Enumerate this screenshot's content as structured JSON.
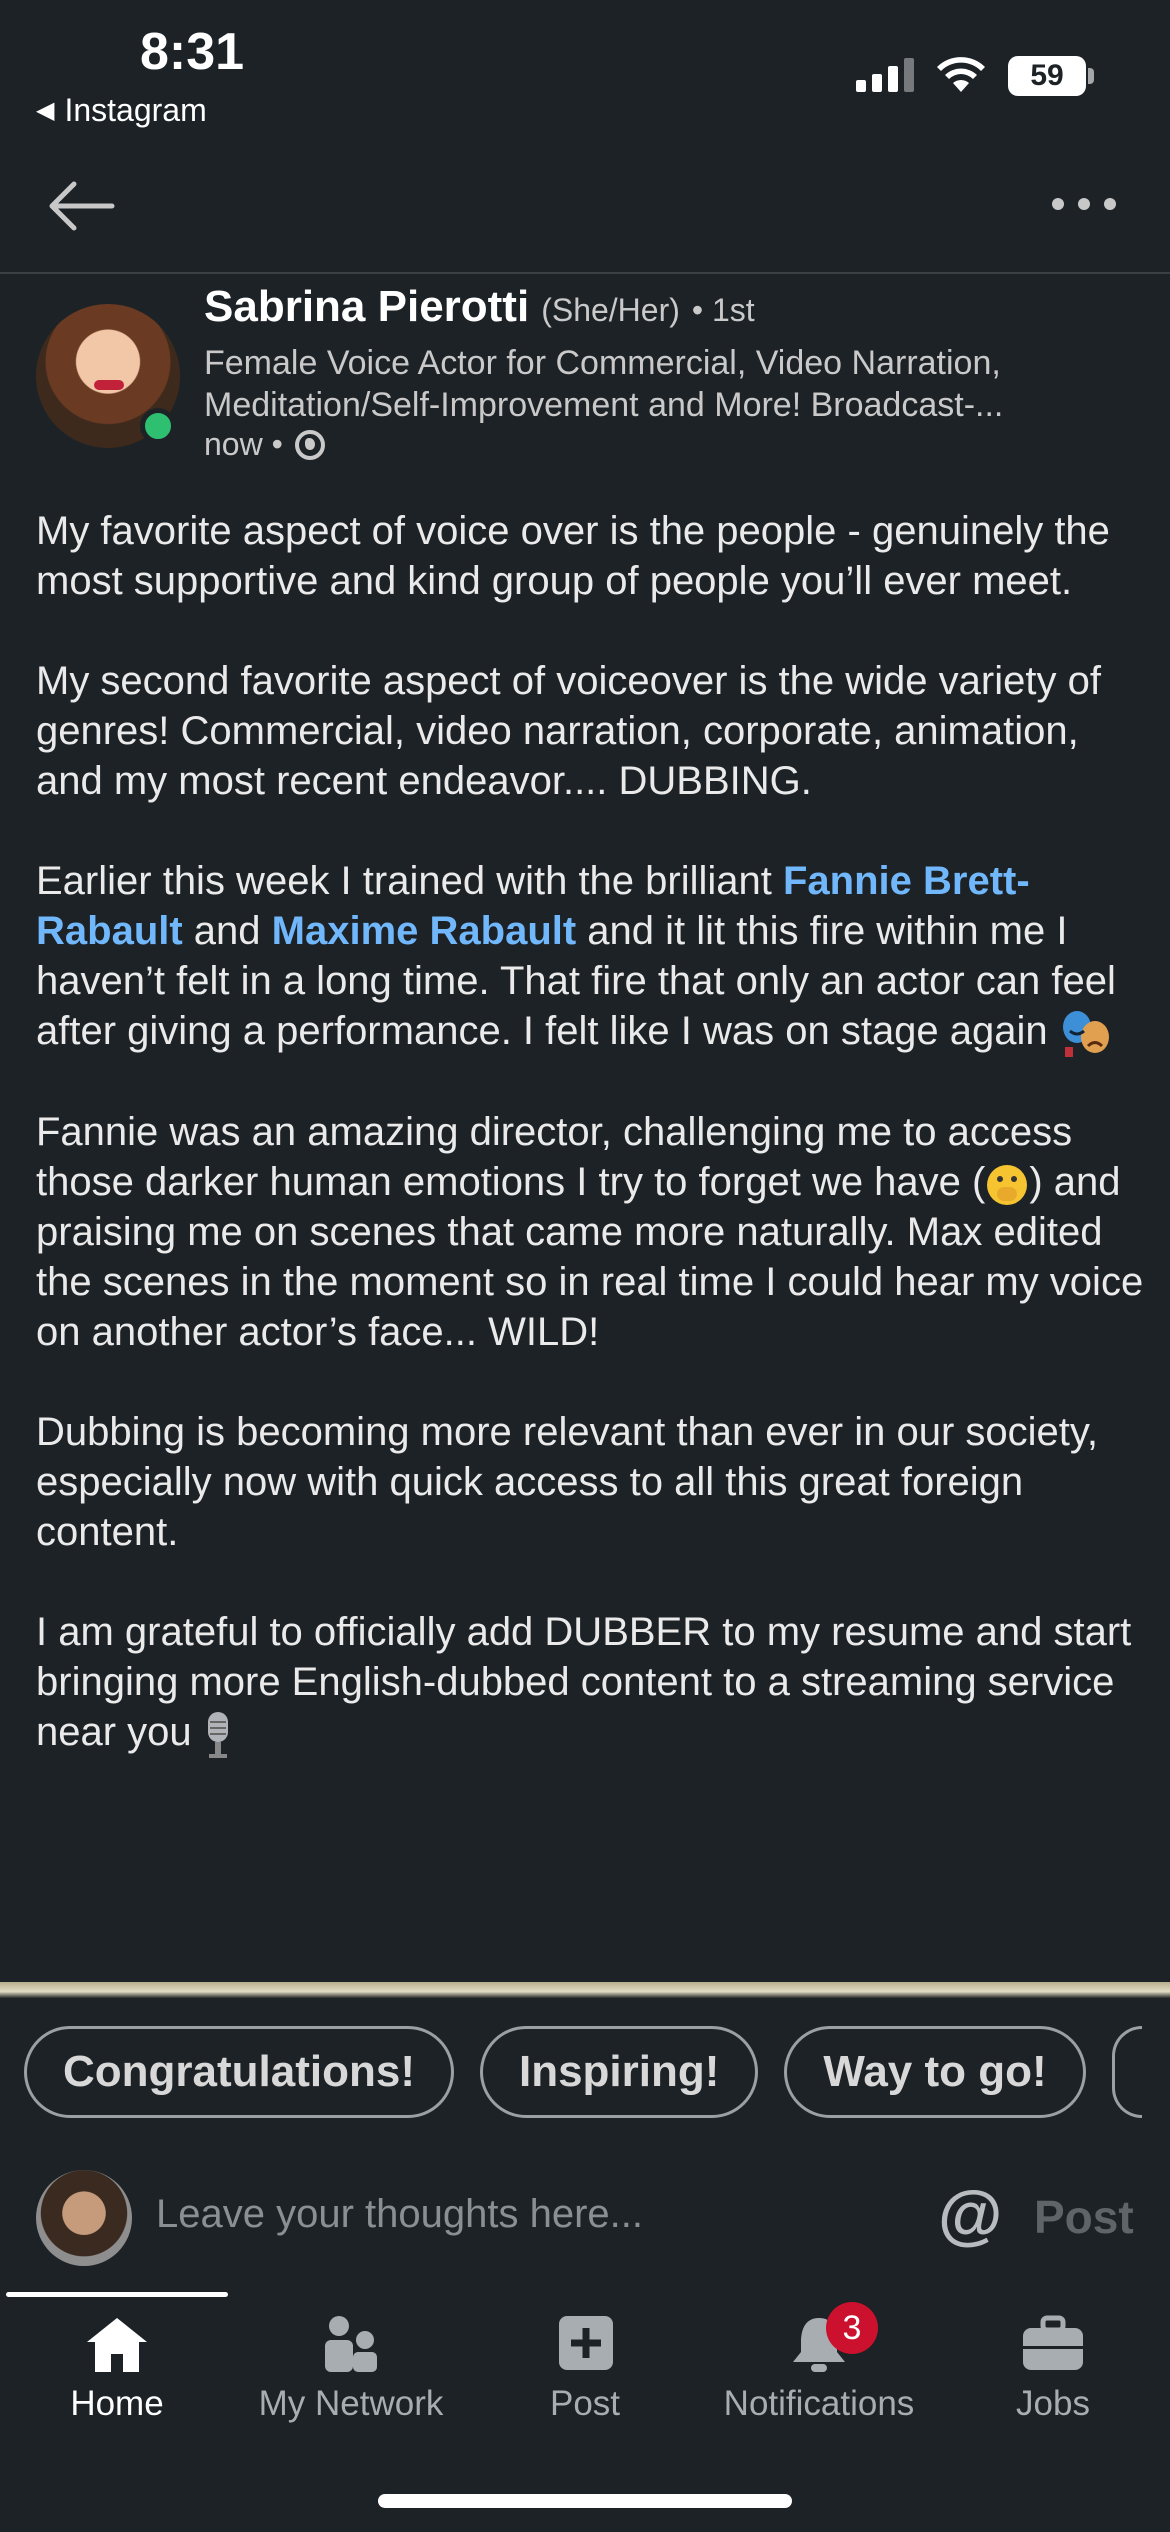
{
  "status_bar": {
    "time": "8:31",
    "back_app": "Instagram",
    "battery": "59"
  },
  "post": {
    "author": {
      "name": "Sabrina Pierotti",
      "pronouns": "(She/Her)",
      "degree": "• 1st",
      "headline": "Female Voice Actor for Commercial, Video Narration, Meditation/Self-Improvement and More! Broadcast-...",
      "time": "now •"
    },
    "p1": "My favorite aspect of voice over is the people - genuinely the most supportive and kind group of people you’ll ever meet.",
    "p2": "My second favorite aspect of voiceover is the wide variety of genres! Commercial, video narration, corporate, animation, and my most recent endeavor.... DUBBING.",
    "p3_a": "Earlier this week I trained with the brilliant ",
    "mention1": "Fannie Brett-Rabault",
    "p3_b": " and ",
    "mention2": "Maxime Rabault",
    "p3_c": " and it lit this fire within me I haven’t felt in a long time. That fire that only an actor can feel after giving a performance. I felt like I was on stage again ",
    "p4_a": "Fannie was an amazing director, challenging me to access those darker human emotions I try to forget we have (",
    "p4_b": ") and praising me on scenes that came more naturally. Max edited the scenes in the moment so in real time I could hear my voice on another actor’s face... WILD!",
    "p5": "Dubbing is becoming more relevant than ever in our society, especially now with quick access to all this great foreign content.",
    "p6": "I am grateful to officially add DUBBER to my resume and start bringing more English-dubbed content to a streaming service near you"
  },
  "chips": [
    "Congratulations!",
    "Inspiring!",
    "Way to go!"
  ],
  "comment": {
    "placeholder": "Leave your thoughts here...",
    "at": "@",
    "post": "Post"
  },
  "tabs": [
    {
      "label": "Home",
      "icon": "home-icon"
    },
    {
      "label": "My Network",
      "icon": "network-icon"
    },
    {
      "label": "Post",
      "icon": "post-icon"
    },
    {
      "label": "Notifications",
      "icon": "bell-icon",
      "badge": "3"
    },
    {
      "label": "Jobs",
      "icon": "briefcase-icon"
    }
  ],
  "colors": {
    "background": "#1d2226",
    "mention": "#71b7fb",
    "badge": "#cb112d",
    "online": "#2fbf71"
  }
}
